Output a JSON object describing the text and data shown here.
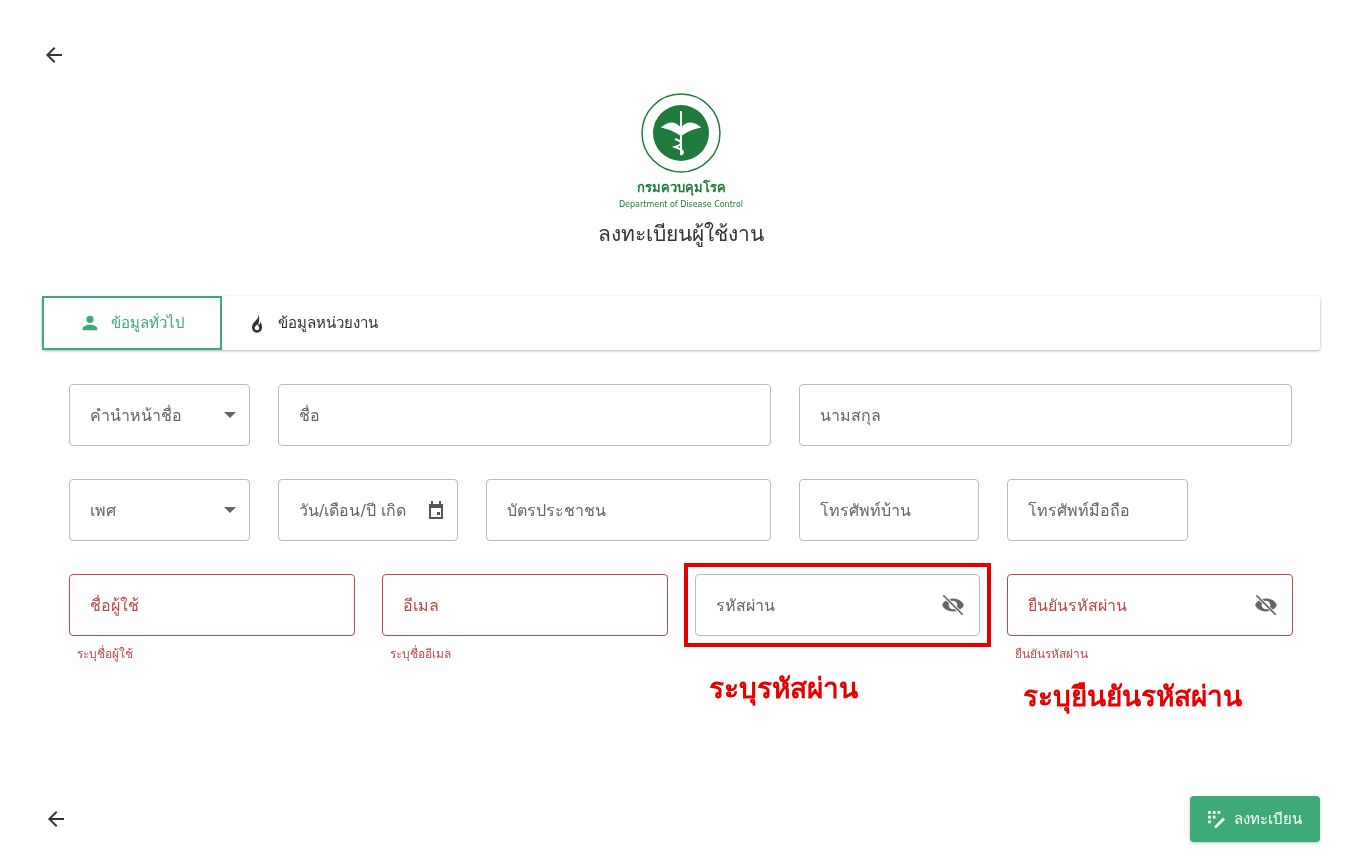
{
  "logo": {
    "name_th": "กรมควบคุมโรค",
    "name_en": "Department of Disease Control"
  },
  "title": "ลงทะเบียนผู้ใช้งาน",
  "tabs": [
    {
      "label": "ข้อมูลทั่วไป",
      "selected": true
    },
    {
      "label": "ข้อมูลหน่วยงาน",
      "selected": false
    }
  ],
  "form_rows": [
    [
      {
        "kind": "select",
        "placeholder": "คำนำหน้าชื่อ",
        "error": false
      },
      {
        "kind": "text",
        "placeholder": "ชื่อ",
        "error": false
      },
      {
        "kind": "text",
        "placeholder": "นามสกุล",
        "error": false
      }
    ],
    [
      {
        "kind": "select",
        "placeholder": "เพศ",
        "error": false
      },
      {
        "kind": "date",
        "placeholder": "วัน/เดือน/ปี เกิด",
        "error": false
      },
      {
        "kind": "text",
        "placeholder": "บัตรประชาชน",
        "error": false
      },
      {
        "kind": "text",
        "placeholder": "โทรศัพท์บ้าน",
        "error": false
      },
      {
        "kind": "text",
        "placeholder": "โทรศัพท์มือถือ",
        "error": false
      }
    ],
    [
      {
        "kind": "text",
        "placeholder": "ชื่อผู้ใช้",
        "error": true,
        "helper": "ระบุชื่อผู้ใช้"
      },
      {
        "kind": "text",
        "placeholder": "อีเมล",
        "error": true,
        "helper": "ระบุชื่ออีเมล"
      },
      {
        "kind": "password",
        "placeholder": "รหัสผ่าน",
        "error": false,
        "highlighted": true,
        "annotation": "ระบุรหัสผ่าน"
      },
      {
        "kind": "password",
        "placeholder": "ยืนยันรหัสผ่าน",
        "error": true,
        "helper": "ยืนยันรหัสผ่าน",
        "annotation": "ระบุยืนยันรหัสผ่าน"
      }
    ]
  ],
  "submit_button": "ลงทะเบียน"
}
